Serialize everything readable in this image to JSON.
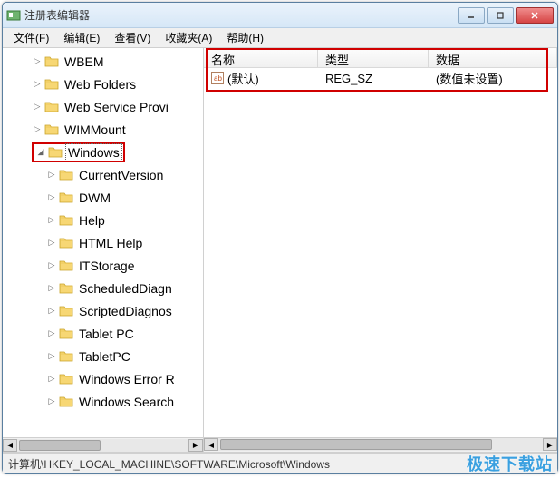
{
  "window": {
    "title": "注册表编辑器"
  },
  "menu": {
    "file": "文件(F)",
    "edit": "编辑(E)",
    "view": "查看(V)",
    "favorites": "收藏夹(A)",
    "help": "帮助(H)"
  },
  "tree": {
    "items": [
      {
        "indent": 2,
        "toggle": "▷",
        "label": "WBEM"
      },
      {
        "indent": 2,
        "toggle": "▷",
        "label": "Web Folders"
      },
      {
        "indent": 2,
        "toggle": "▷",
        "label": "Web Service Provi"
      },
      {
        "indent": 2,
        "toggle": "▷",
        "label": "WIMMount"
      },
      {
        "indent": 2,
        "toggle": "◢",
        "label": "Windows",
        "selected": true,
        "highlighted": true
      },
      {
        "indent": 3,
        "toggle": "▷",
        "label": "CurrentVersion"
      },
      {
        "indent": 3,
        "toggle": "▷",
        "label": "DWM"
      },
      {
        "indent": 3,
        "toggle": "▷",
        "label": "Help"
      },
      {
        "indent": 3,
        "toggle": "▷",
        "label": "HTML Help"
      },
      {
        "indent": 3,
        "toggle": "▷",
        "label": "ITStorage"
      },
      {
        "indent": 3,
        "toggle": "▷",
        "label": "ScheduledDiagn"
      },
      {
        "indent": 3,
        "toggle": "▷",
        "label": "ScriptedDiagnos"
      },
      {
        "indent": 3,
        "toggle": "▷",
        "label": "Tablet PC"
      },
      {
        "indent": 3,
        "toggle": "▷",
        "label": "TabletPC"
      },
      {
        "indent": 3,
        "toggle": "▷",
        "label": "Windows Error R"
      },
      {
        "indent": 3,
        "toggle": "▷",
        "label": "Windows Search"
      }
    ]
  },
  "list": {
    "columns": {
      "name": "名称",
      "type": "类型",
      "data": "数据"
    },
    "rows": [
      {
        "name": "(默认)",
        "type": "REG_SZ",
        "data": "(数值未设置)"
      }
    ]
  },
  "statusbar": {
    "path": "计算机\\HKEY_LOCAL_MACHINE\\SOFTWARE\\Microsoft\\Windows"
  },
  "watermark": "极速下载站"
}
